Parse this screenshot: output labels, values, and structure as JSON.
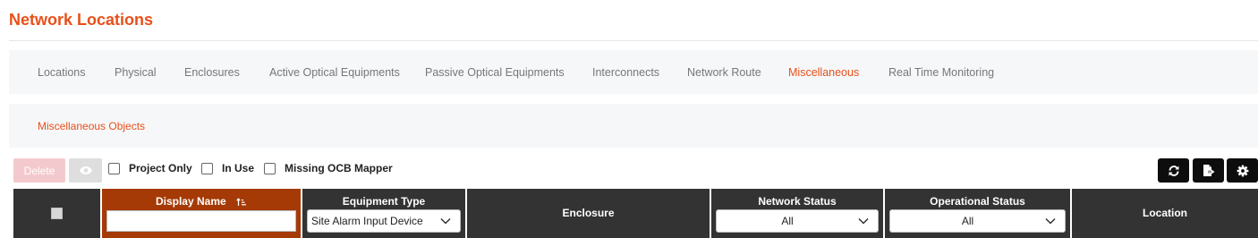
{
  "page": {
    "title": "Network Locations"
  },
  "tabs": [
    {
      "label": "Locations"
    },
    {
      "label": "Physical"
    },
    {
      "label": "Enclosures"
    },
    {
      "label": "Active Optical Equipments"
    },
    {
      "label": "Passive Optical Equipments"
    },
    {
      "label": "Interconnects"
    },
    {
      "label": "Network Route"
    },
    {
      "label": "Miscellaneous",
      "active": true
    },
    {
      "label": "Real Time Monitoring"
    }
  ],
  "subtabs": [
    {
      "label": "Miscellaneous Objects",
      "active": true
    }
  ],
  "toolbar": {
    "delete_label": "Delete",
    "filters": [
      {
        "label": "Project Only",
        "checked": false
      },
      {
        "label": "In Use",
        "checked": false
      },
      {
        "label": "Missing OCB Mapper",
        "checked": false
      }
    ],
    "right_icons": [
      "refresh-icon",
      "export-icon",
      "settings-icon"
    ]
  },
  "table": {
    "columns": [
      {
        "title": "",
        "kind": "select-all"
      },
      {
        "title": "Display Name",
        "kind": "text-filter",
        "sorted": "asc",
        "sort_icon": "sort-ascending-icon",
        "value": ""
      },
      {
        "title": "Equipment Type",
        "kind": "select",
        "value": "Site Alarm Input Device"
      },
      {
        "title": "Enclosure",
        "kind": "none"
      },
      {
        "title": "Network Status",
        "kind": "select",
        "value": "All"
      },
      {
        "title": "Operational Status",
        "kind": "select",
        "value": "All"
      },
      {
        "title": "Location",
        "kind": "none"
      }
    ]
  },
  "colors": {
    "accent": "#e8501a",
    "sorted_header": "#a53a06",
    "header": "#333333",
    "tab_bar": "#f6f7f9",
    "delete_disabled": "#f4c9cd"
  }
}
